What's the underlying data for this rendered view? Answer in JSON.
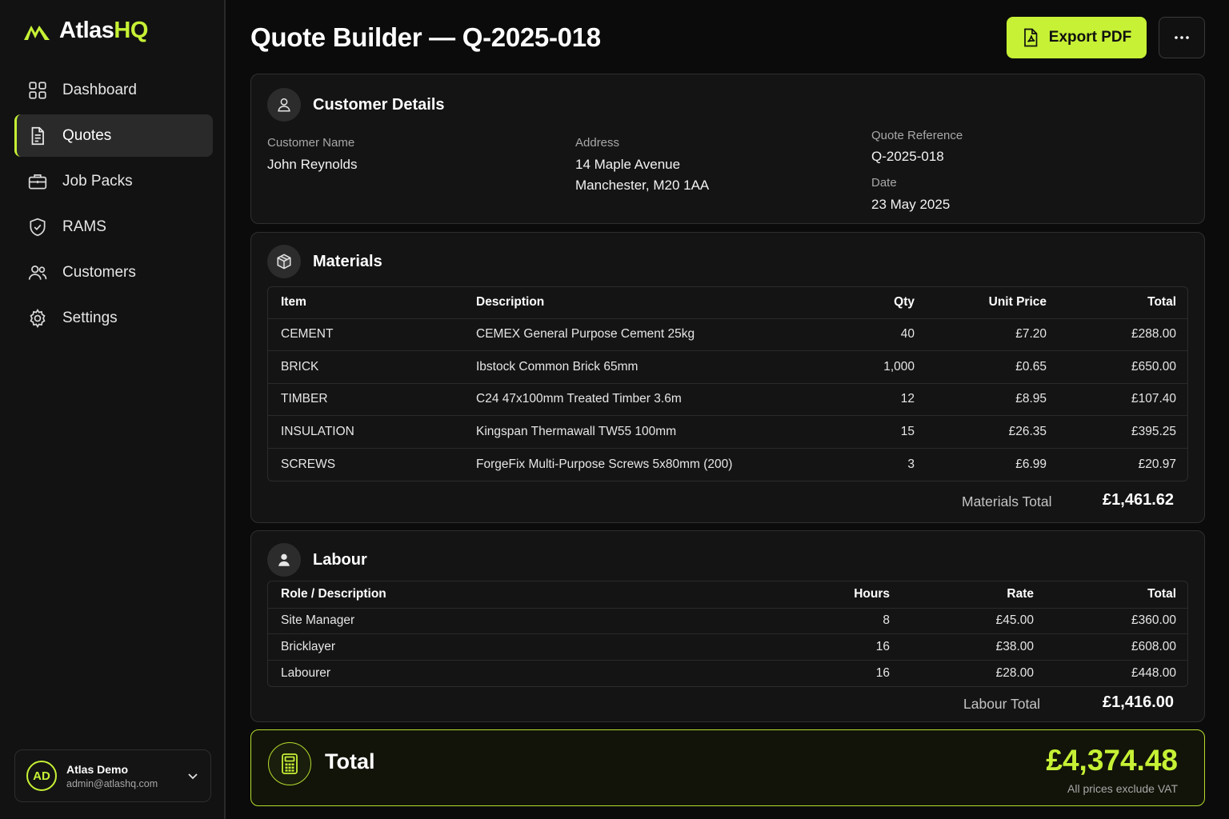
{
  "brand": {
    "name_part1": "Atlas",
    "name_part2": "HQ",
    "accent": "#c6f135"
  },
  "sidebar": {
    "items": [
      {
        "label": "Dashboard",
        "icon": "grid-icon"
      },
      {
        "label": "Quotes",
        "icon": "document-icon",
        "active": true
      },
      {
        "label": "Job Packs",
        "icon": "briefcase-icon"
      },
      {
        "label": "RAMS",
        "icon": "shield-check-icon"
      },
      {
        "label": "Customers",
        "icon": "users-icon"
      },
      {
        "label": "Settings",
        "icon": "gear-icon"
      }
    ],
    "user": {
      "initials": "AD",
      "name": "Atlas Demo",
      "email": "admin@atlashq.com"
    }
  },
  "header": {
    "title": "Quote Builder — Q-2025-018",
    "export_label": "Export PDF"
  },
  "customer": {
    "title": "Customer Details",
    "name_label": "Customer Name",
    "name": "John Reynolds",
    "address_label": "Address",
    "address_line1": "14 Maple Avenue",
    "address_line2": "Manchester, M20 1AA",
    "ref_label": "Quote Reference",
    "ref": "Q-2025-018",
    "date_label": "Date",
    "date": "23 May 2025"
  },
  "materials": {
    "title": "Materials",
    "headers": {
      "item": "Item",
      "description": "Description",
      "qty": "Qty",
      "unit_price": "Unit Price",
      "total": "Total"
    },
    "rows": [
      {
        "item": "CEMENT",
        "description": "CEMEX General Purpose Cement 25kg",
        "qty": "40",
        "unit_price": "£7.20",
        "total": "£288.00"
      },
      {
        "item": "BRICK",
        "description": "Ibstock Common Brick 65mm",
        "qty": "1,000",
        "unit_price": "£0.65",
        "total": "£650.00"
      },
      {
        "item": "TIMBER",
        "description": "C24 47x100mm Treated Timber 3.6m",
        "qty": "12",
        "unit_price": "£8.95",
        "total": "£107.40"
      },
      {
        "item": "INSULATION",
        "description": "Kingspan Thermawall TW55 100mm",
        "qty": "15",
        "unit_price": "£26.35",
        "total": "£395.25"
      },
      {
        "item": "SCREWS",
        "description": "ForgeFix Multi-Purpose Screws 5x80mm (200)",
        "qty": "3",
        "unit_price": "£6.99",
        "total": "£20.97"
      }
    ],
    "total_label": "Materials Total",
    "total_value": "£1,461.62"
  },
  "labour": {
    "title": "Labour",
    "headers": {
      "role": "Role / Description",
      "hours": "Hours",
      "rate": "Rate",
      "total": "Total"
    },
    "rows": [
      {
        "role": "Site Manager",
        "hours": "8",
        "rate": "£45.00",
        "total": "£360.00"
      },
      {
        "role": "Bricklayer",
        "hours": "16",
        "rate": "£38.00",
        "total": "£608.00"
      },
      {
        "role": "Labourer",
        "hours": "16",
        "rate": "£28.00",
        "total": "£448.00"
      }
    ],
    "total_label": "Labour Total",
    "total_value": "£1,416.00"
  },
  "grand_total": {
    "label": "Total",
    "value": "£4,374.48",
    "note": "All prices exclude VAT"
  }
}
